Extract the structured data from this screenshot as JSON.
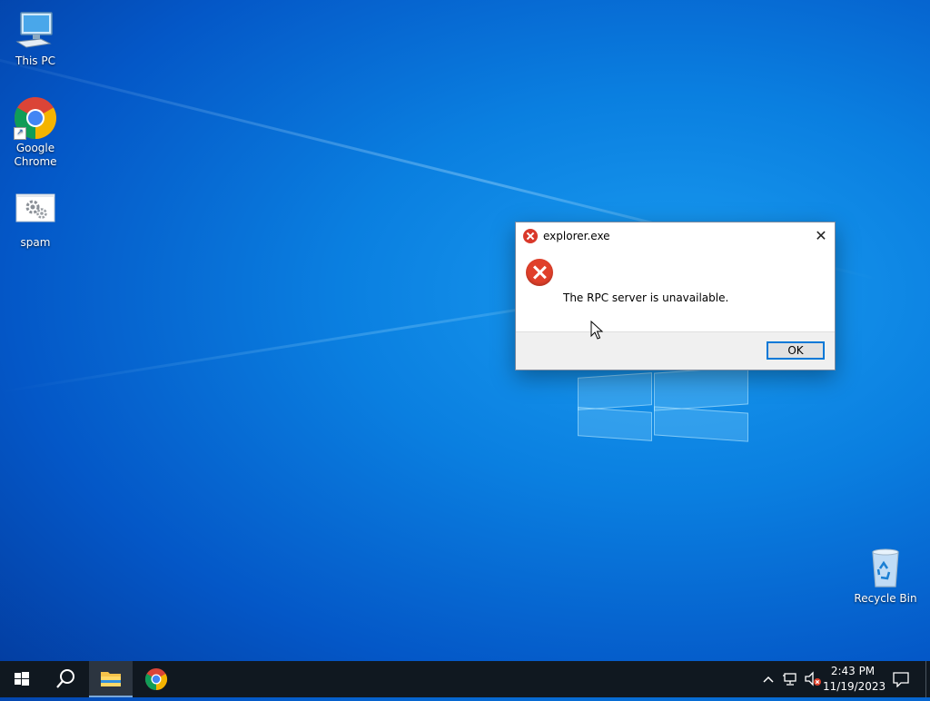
{
  "desktop": {
    "icons": [
      {
        "label": "This PC",
        "icon": "monitor-icon"
      },
      {
        "label": "Google Chrome",
        "icon": "chrome-icon"
      },
      {
        "label": "spam",
        "icon": "settings-file-icon"
      },
      {
        "label": "Recycle Bin",
        "icon": "recycle-bin-icon"
      }
    ]
  },
  "dialog": {
    "title": "explorer.exe",
    "message": "The RPC server is unavailable.",
    "ok_label": "OK",
    "close_glyph": "✕"
  },
  "taskbar": {
    "time": "2:43 PM",
    "date": "11/19/2023",
    "pinned": [
      "windows-start-icon",
      "search-icon",
      "file-explorer-icon",
      "chrome-icon"
    ],
    "tray_icons": [
      "chevron-up-icon",
      "network-icon",
      "volume-muted-icon",
      "notification-icon"
    ]
  },
  "colors": {
    "desktop_blue": "#0a7fe0",
    "error_red": "#e0402b",
    "taskbar": "#101820",
    "accent": "#0078d7"
  }
}
